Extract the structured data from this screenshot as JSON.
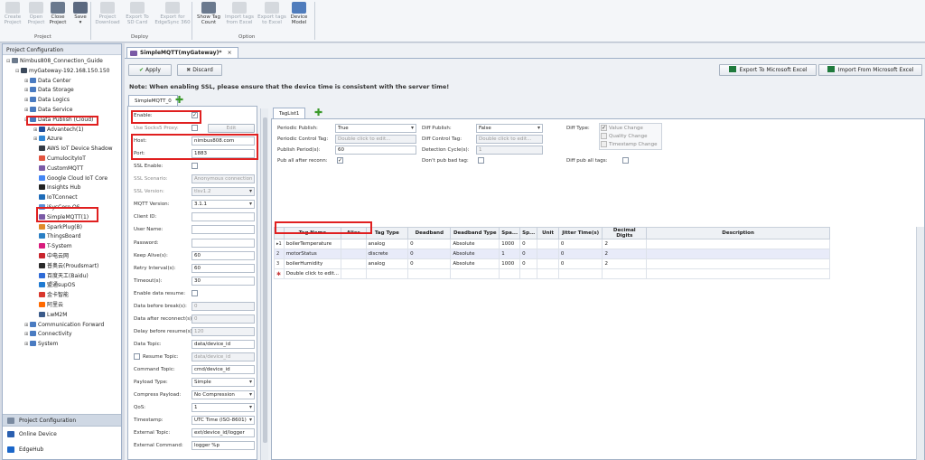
{
  "ribbon": {
    "buttons": [
      {
        "label": "Create\nProject",
        "enabled": false
      },
      {
        "label": "Open\nProject",
        "enabled": false
      },
      {
        "label": "Close\nProject",
        "enabled": true
      },
      {
        "label": "Save\n▾",
        "enabled": true
      },
      {
        "label": "Project\nDownload",
        "enabled": false
      },
      {
        "label": "Export To\nSD Card",
        "enabled": false
      },
      {
        "label": "Export for\nEdgeSync 360",
        "enabled": false
      },
      {
        "label": "Show Tag\nCount",
        "enabled": true
      },
      {
        "label": "Import tags\nfrom Excel",
        "enabled": false
      },
      {
        "label": "Export tags\nto Excel",
        "enabled": false
      },
      {
        "label": "Device\nModel",
        "enabled": true
      }
    ],
    "groups": [
      "Project",
      "Deploy",
      "Option"
    ]
  },
  "sidebar": {
    "title": "Project Configuration",
    "tree": [
      {
        "label": "Nimbus808_Connection_Guide",
        "level": 0,
        "expander": "⊟",
        "icon": "project-icon",
        "color": "#6c7a8c"
      },
      {
        "label": "myGateway-192.168.150.150",
        "level": 1,
        "expander": "⊟",
        "icon": "gateway-icon",
        "color": "#3c4a5c"
      },
      {
        "label": "Data Center",
        "level": 2,
        "expander": "⊞",
        "icon": "folder-icon",
        "color": "#4a7bc1"
      },
      {
        "label": "Data Storage",
        "level": 2,
        "expander": "⊞",
        "icon": "database-icon",
        "color": "#4a7bc1"
      },
      {
        "label": "Data Logics",
        "level": 2,
        "expander": "⊞",
        "icon": "logic-icon",
        "color": "#4a7bc1"
      },
      {
        "label": "Data Service",
        "level": 2,
        "expander": "⊞",
        "icon": "service-icon",
        "color": "#4a7bc1"
      },
      {
        "label": "Data Publish (Cloud)",
        "level": 2,
        "expander": "⊟",
        "icon": "cloud-icon",
        "color": "#4a7bc1"
      },
      {
        "label": "Advantech(1)",
        "level": 3,
        "expander": "⊞",
        "icon": "advantech-icon",
        "color": "#1f4f9c"
      },
      {
        "label": "Azure",
        "level": 3,
        "expander": "⊞",
        "icon": "azure-icon",
        "color": "#2f86d6"
      },
      {
        "label": "AWS IoT Device Shadow",
        "level": 3,
        "expander": "",
        "icon": "aws-icon",
        "color": "#333a44"
      },
      {
        "label": "CumulocityIoT",
        "level": 3,
        "expander": "",
        "icon": "cumulocity-icon",
        "color": "#e2533e"
      },
      {
        "label": "CustomMQTT",
        "level": 3,
        "expander": "",
        "icon": "mqtt-icon",
        "color": "#7a5aa6"
      },
      {
        "label": "Google Cloud IoT Core",
        "level": 3,
        "expander": "",
        "icon": "google-cloud-icon",
        "color": "#4285f4"
      },
      {
        "label": "Insights Hub",
        "level": 3,
        "expander": "",
        "icon": "insights-hub-icon",
        "color": "#222"
      },
      {
        "label": "IoTConnect",
        "level": 3,
        "expander": "",
        "icon": "iotconnect-icon",
        "color": "#1e6bb8"
      },
      {
        "label": "iSysCore OS",
        "level": 3,
        "expander": "",
        "icon": "isyscore-icon",
        "color": "#5a8fd6"
      },
      {
        "label": "SimpleMQTT(1)",
        "level": 3,
        "expander": "",
        "icon": "simplemqtt-icon",
        "color": "#7a5aa6"
      },
      {
        "label": "SparkPlug(B)",
        "level": 3,
        "expander": "",
        "icon": "sparkplug-icon",
        "color": "#e08a2a"
      },
      {
        "label": "ThingsBoard",
        "level": 3,
        "expander": "",
        "icon": "thingsboard-icon",
        "color": "#2a7fc4"
      },
      {
        "label": "T-System",
        "level": 3,
        "expander": "",
        "icon": "tsystem-icon",
        "color": "#d81b7c"
      },
      {
        "label": "中电云网",
        "level": 3,
        "expander": "",
        "icon": "cec-icon",
        "color": "#c8252c"
      },
      {
        "label": "普奥云(Proudsmart)",
        "level": 3,
        "expander": "",
        "icon": "proudsmart-icon",
        "color": "#2a2a2a"
      },
      {
        "label": "百度天工(Baidu)",
        "level": 3,
        "expander": "",
        "icon": "baidu-icon",
        "color": "#2f6bd6"
      },
      {
        "label": "盟通supOS",
        "level": 3,
        "expander": "",
        "icon": "supos-icon",
        "color": "#1f7ad1"
      },
      {
        "label": "金卡智能",
        "level": 3,
        "expander": "",
        "icon": "jinka-icon",
        "color": "#d8372c"
      },
      {
        "label": "阿里云",
        "level": 3,
        "expander": "",
        "icon": "aliyun-icon",
        "color": "#ff6a00"
      },
      {
        "label": "LwM2M",
        "level": 3,
        "expander": "",
        "icon": "lwm2m-icon",
        "color": "#3b5b8a"
      },
      {
        "label": "Communication Forward",
        "level": 2,
        "expander": "⊞",
        "icon": "forward-icon",
        "color": "#4a7bc1"
      },
      {
        "label": "Connectivity",
        "level": 2,
        "expander": "⊞",
        "icon": "connectivity-icon",
        "color": "#4a7bc1"
      },
      {
        "label": "System",
        "level": 2,
        "expander": "⊞",
        "icon": "system-icon",
        "color": "#4a7bc1"
      }
    ],
    "bottom": [
      "Project Configuration",
      "Online Device",
      "EdgeHub"
    ]
  },
  "doc_tab": "SimpleMQTT(myGateway)*",
  "toolbar": {
    "apply": "Apply",
    "discard": "Discard",
    "export_excel": "Export To Microsoft Excel",
    "import_excel": "Import From Microsoft Excel"
  },
  "note": "Note: When enabling SSL, please ensure that the device time is consistent with the server time!",
  "config_tab": "SimpleMQTT_0",
  "form": {
    "fields": [
      {
        "label": "Enable:",
        "type": "check",
        "checked": true,
        "enabled": true
      },
      {
        "label": "Use Socks5 Proxy:",
        "type": "check-edit",
        "checked": false,
        "enabled": true,
        "button": "Edit"
      },
      {
        "label": "Host:",
        "type": "text",
        "value": "nimbus808.com",
        "enabled": true
      },
      {
        "label": "Port:",
        "type": "text",
        "value": "1883",
        "enabled": true
      },
      {
        "label": "SSL Enable:",
        "type": "check",
        "checked": false,
        "enabled": true
      },
      {
        "label": "SSL Scenario:",
        "type": "text",
        "value": "Anonymous connection",
        "enabled": false
      },
      {
        "label": "SSL Version:",
        "type": "select",
        "value": "tlsv1.2",
        "enabled": false
      },
      {
        "label": "MQTT Version:",
        "type": "select",
        "value": "3.1.1",
        "enabled": true
      },
      {
        "label": "Client ID:",
        "type": "text",
        "value": "",
        "enabled": true
      },
      {
        "label": "User Name:",
        "type": "text",
        "value": "",
        "enabled": true
      },
      {
        "label": "Password:",
        "type": "text",
        "value": "",
        "enabled": true
      },
      {
        "label": "Keep Alive(s):",
        "type": "text",
        "value": "60",
        "enabled": true
      },
      {
        "label": "Retry Interval(s):",
        "type": "text",
        "value": "60",
        "enabled": true
      },
      {
        "label": "Timeout(s):",
        "type": "text",
        "value": "30",
        "enabled": true
      },
      {
        "label": "Enable data resume:",
        "type": "check",
        "checked": false,
        "enabled": true
      },
      {
        "label": "Data before break(s):",
        "type": "text",
        "value": "0",
        "enabled": false
      },
      {
        "label": "Data after reconnect(s):",
        "type": "text",
        "value": "0",
        "enabled": false
      },
      {
        "label": "Delay before resume(s):",
        "type": "text",
        "value": "120",
        "enabled": false
      },
      {
        "label": "Data Topic:",
        "type": "text",
        "value": "data/device_id",
        "enabled": true
      },
      {
        "label": "Resume Topic:",
        "type": "check-text",
        "checked": false,
        "value": "data/device_id",
        "enabled": false
      },
      {
        "label": "Command Topic:",
        "type": "text",
        "value": "cmd/device_id",
        "enabled": true
      },
      {
        "label": "Payload Type:",
        "type": "select",
        "value": "Simple",
        "enabled": true
      },
      {
        "label": "Compress Payload:",
        "type": "select",
        "value": "No Compression",
        "enabled": true
      },
      {
        "label": "QoS:",
        "type": "select",
        "value": "1",
        "enabled": true
      },
      {
        "label": "Timestamp:",
        "type": "select",
        "value": "UTC Time (ISO-8601)",
        "enabled": true
      },
      {
        "label": "External Topic:",
        "type": "text",
        "value": "ext/device_id/logger",
        "enabled": true
      },
      {
        "label": "External Command:",
        "type": "text",
        "value": "logger %p",
        "enabled": true
      }
    ]
  },
  "taglist": {
    "tab": "TagList1",
    "opts": {
      "periodic_publish_label": "Periodic Publish:",
      "periodic_publish": "True",
      "periodic_control_label": "Periodic Control Tag:",
      "periodic_control": "Double click to edit...",
      "publish_period_label": "Publish Period(s):",
      "publish_period": "60",
      "pub_all_label": "Pub all after reconn:",
      "diff_publish_label": "Diff Publish:",
      "diff_publish": "False",
      "diff_control_label": "Diff Control Tag:",
      "diff_control": "Double click to edit...",
      "detection_label": "Detection Cycle(s):",
      "detection": "1",
      "dont_pub_bad_label": "Don't pub bad tag:",
      "diff_type_label": "Diff Type:",
      "value_change": "Value Change",
      "quality_change": "Quality Change",
      "timestamp_change": "Timestamp Change",
      "diff_pub_all_label": "Diff pub all tags:"
    },
    "columns": [
      "Tag Name",
      "Alias",
      "Tag Type",
      "Deadband",
      "Deadband Type",
      "Spa...",
      "Sp...",
      "Unit",
      "Jitter Time(s)",
      "Decimal Digits",
      "Description"
    ],
    "rows": [
      {
        "num": "1",
        "cells": [
          "boilerTemperature",
          "",
          "analog",
          "0",
          "Absolute",
          "1000",
          "0",
          "",
          "0",
          "2",
          ""
        ]
      },
      {
        "num": "2",
        "cells": [
          "motorStatus",
          "",
          "discrete",
          "0",
          "Absolute",
          "1",
          "0",
          "",
          "0",
          "2",
          ""
        ]
      },
      {
        "num": "3",
        "cells": [
          "boilerHumidity",
          "",
          "analog",
          "0",
          "Absolute",
          "1000",
          "0",
          "",
          "0",
          "2",
          ""
        ]
      }
    ],
    "new_row": "Double click to edit..."
  }
}
